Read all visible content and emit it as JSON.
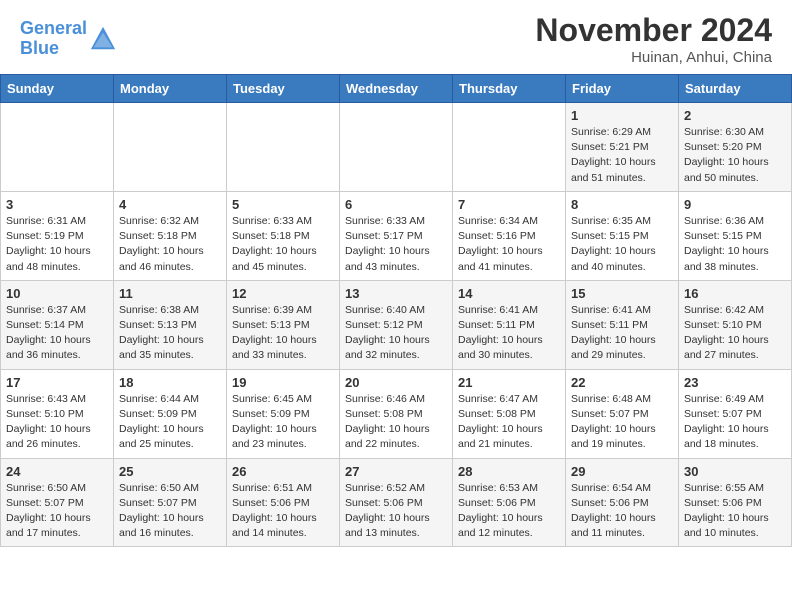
{
  "header": {
    "logo_line1": "General",
    "logo_line2": "Blue",
    "month": "November 2024",
    "location": "Huinan, Anhui, China"
  },
  "weekdays": [
    "Sunday",
    "Monday",
    "Tuesday",
    "Wednesday",
    "Thursday",
    "Friday",
    "Saturday"
  ],
  "weeks": [
    [
      {
        "day": "",
        "info": ""
      },
      {
        "day": "",
        "info": ""
      },
      {
        "day": "",
        "info": ""
      },
      {
        "day": "",
        "info": ""
      },
      {
        "day": "",
        "info": ""
      },
      {
        "day": "1",
        "info": "Sunrise: 6:29 AM\nSunset: 5:21 PM\nDaylight: 10 hours\nand 51 minutes."
      },
      {
        "day": "2",
        "info": "Sunrise: 6:30 AM\nSunset: 5:20 PM\nDaylight: 10 hours\nand 50 minutes."
      }
    ],
    [
      {
        "day": "3",
        "info": "Sunrise: 6:31 AM\nSunset: 5:19 PM\nDaylight: 10 hours\nand 48 minutes."
      },
      {
        "day": "4",
        "info": "Sunrise: 6:32 AM\nSunset: 5:18 PM\nDaylight: 10 hours\nand 46 minutes."
      },
      {
        "day": "5",
        "info": "Sunrise: 6:33 AM\nSunset: 5:18 PM\nDaylight: 10 hours\nand 45 minutes."
      },
      {
        "day": "6",
        "info": "Sunrise: 6:33 AM\nSunset: 5:17 PM\nDaylight: 10 hours\nand 43 minutes."
      },
      {
        "day": "7",
        "info": "Sunrise: 6:34 AM\nSunset: 5:16 PM\nDaylight: 10 hours\nand 41 minutes."
      },
      {
        "day": "8",
        "info": "Sunrise: 6:35 AM\nSunset: 5:15 PM\nDaylight: 10 hours\nand 40 minutes."
      },
      {
        "day": "9",
        "info": "Sunrise: 6:36 AM\nSunset: 5:15 PM\nDaylight: 10 hours\nand 38 minutes."
      }
    ],
    [
      {
        "day": "10",
        "info": "Sunrise: 6:37 AM\nSunset: 5:14 PM\nDaylight: 10 hours\nand 36 minutes."
      },
      {
        "day": "11",
        "info": "Sunrise: 6:38 AM\nSunset: 5:13 PM\nDaylight: 10 hours\nand 35 minutes."
      },
      {
        "day": "12",
        "info": "Sunrise: 6:39 AM\nSunset: 5:13 PM\nDaylight: 10 hours\nand 33 minutes."
      },
      {
        "day": "13",
        "info": "Sunrise: 6:40 AM\nSunset: 5:12 PM\nDaylight: 10 hours\nand 32 minutes."
      },
      {
        "day": "14",
        "info": "Sunrise: 6:41 AM\nSunset: 5:11 PM\nDaylight: 10 hours\nand 30 minutes."
      },
      {
        "day": "15",
        "info": "Sunrise: 6:41 AM\nSunset: 5:11 PM\nDaylight: 10 hours\nand 29 minutes."
      },
      {
        "day": "16",
        "info": "Sunrise: 6:42 AM\nSunset: 5:10 PM\nDaylight: 10 hours\nand 27 minutes."
      }
    ],
    [
      {
        "day": "17",
        "info": "Sunrise: 6:43 AM\nSunset: 5:10 PM\nDaylight: 10 hours\nand 26 minutes."
      },
      {
        "day": "18",
        "info": "Sunrise: 6:44 AM\nSunset: 5:09 PM\nDaylight: 10 hours\nand 25 minutes."
      },
      {
        "day": "19",
        "info": "Sunrise: 6:45 AM\nSunset: 5:09 PM\nDaylight: 10 hours\nand 23 minutes."
      },
      {
        "day": "20",
        "info": "Sunrise: 6:46 AM\nSunset: 5:08 PM\nDaylight: 10 hours\nand 22 minutes."
      },
      {
        "day": "21",
        "info": "Sunrise: 6:47 AM\nSunset: 5:08 PM\nDaylight: 10 hours\nand 21 minutes."
      },
      {
        "day": "22",
        "info": "Sunrise: 6:48 AM\nSunset: 5:07 PM\nDaylight: 10 hours\nand 19 minutes."
      },
      {
        "day": "23",
        "info": "Sunrise: 6:49 AM\nSunset: 5:07 PM\nDaylight: 10 hours\nand 18 minutes."
      }
    ],
    [
      {
        "day": "24",
        "info": "Sunrise: 6:50 AM\nSunset: 5:07 PM\nDaylight: 10 hours\nand 17 minutes."
      },
      {
        "day": "25",
        "info": "Sunrise: 6:50 AM\nSunset: 5:07 PM\nDaylight: 10 hours\nand 16 minutes."
      },
      {
        "day": "26",
        "info": "Sunrise: 6:51 AM\nSunset: 5:06 PM\nDaylight: 10 hours\nand 14 minutes."
      },
      {
        "day": "27",
        "info": "Sunrise: 6:52 AM\nSunset: 5:06 PM\nDaylight: 10 hours\nand 13 minutes."
      },
      {
        "day": "28",
        "info": "Sunrise: 6:53 AM\nSunset: 5:06 PM\nDaylight: 10 hours\nand 12 minutes."
      },
      {
        "day": "29",
        "info": "Sunrise: 6:54 AM\nSunset: 5:06 PM\nDaylight: 10 hours\nand 11 minutes."
      },
      {
        "day": "30",
        "info": "Sunrise: 6:55 AM\nSunset: 5:06 PM\nDaylight: 10 hours\nand 10 minutes."
      }
    ]
  ]
}
